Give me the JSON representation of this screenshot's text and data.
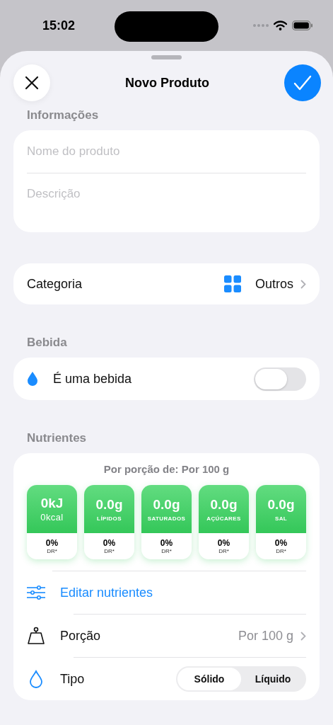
{
  "status_bar": {
    "time": "15:02"
  },
  "header": {
    "title": "Novo Produto"
  },
  "info": {
    "label": "Informações",
    "fields": [
      {
        "placeholder": "Nome do produto"
      },
      {
        "placeholder": "Descrição"
      }
    ]
  },
  "category": {
    "label": "Categoria",
    "value": "Outros"
  },
  "drink": {
    "label": "Bebida",
    "toggle_label": "É uma bebida",
    "on": false
  },
  "nutrients": {
    "label": "Nutrientes",
    "portion_caption": "Por porção de: Por 100 g",
    "tiles": [
      {
        "value": "0kJ",
        "sub": "0kcal",
        "kind": "energy",
        "percent": "0%",
        "dr": "DR*"
      },
      {
        "value": "0.0g",
        "sub": "LÍPIDOS",
        "kind": "nutrient",
        "percent": "0%",
        "dr": "DR*"
      },
      {
        "value": "0.0g",
        "sub": "SATURADOS",
        "kind": "nutrient",
        "percent": "0%",
        "dr": "DR*"
      },
      {
        "value": "0.0g",
        "sub": "AÇÚCARES",
        "kind": "nutrient",
        "percent": "0%",
        "dr": "DR*"
      },
      {
        "value": "0.0g",
        "sub": "SAL",
        "kind": "nutrient",
        "percent": "0%",
        "dr": "DR*"
      }
    ],
    "edit_label": "Editar nutrientes",
    "portion": {
      "label": "Porção",
      "value": "Por 100 g"
    },
    "type": {
      "label": "Tipo",
      "options": [
        {
          "label": "Sólido",
          "selected": true
        },
        {
          "label": "Líquido",
          "selected": false
        }
      ]
    }
  }
}
